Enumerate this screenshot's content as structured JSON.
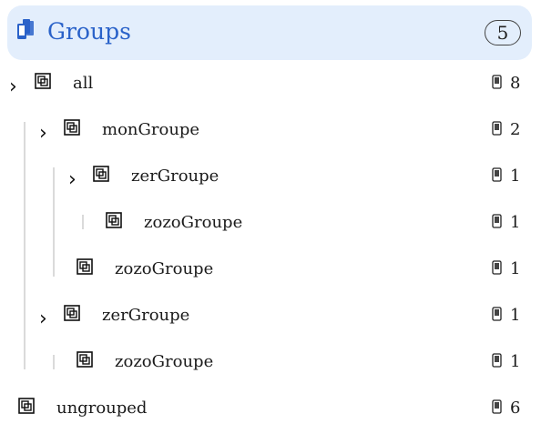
{
  "header": {
    "title": "Groups",
    "count": "5",
    "icon": "devices-icon"
  },
  "colors": {
    "header_bg": "#e3eefc",
    "title": "#2a62c9",
    "tree_line": "#dadada"
  },
  "tree": {
    "rows": [
      {
        "label": "all",
        "count": "8",
        "expandable": true,
        "level": 0
      },
      {
        "label": "monGroupe",
        "count": "2",
        "expandable": true,
        "level": 1
      },
      {
        "label": "zerGroupe",
        "count": "1",
        "expandable": true,
        "level": 2
      },
      {
        "label": "zozoGroupe",
        "count": "1",
        "expandable": false,
        "level": 3
      },
      {
        "label": "zozoGroupe",
        "count": "1",
        "expandable": false,
        "level": 2
      },
      {
        "label": "zerGroupe",
        "count": "1",
        "expandable": true,
        "level": 1
      },
      {
        "label": "zozoGroupe",
        "count": "1",
        "expandable": false,
        "level": 2
      },
      {
        "label": "ungrouped",
        "count": "6",
        "expandable": false,
        "level": 0
      }
    ]
  }
}
